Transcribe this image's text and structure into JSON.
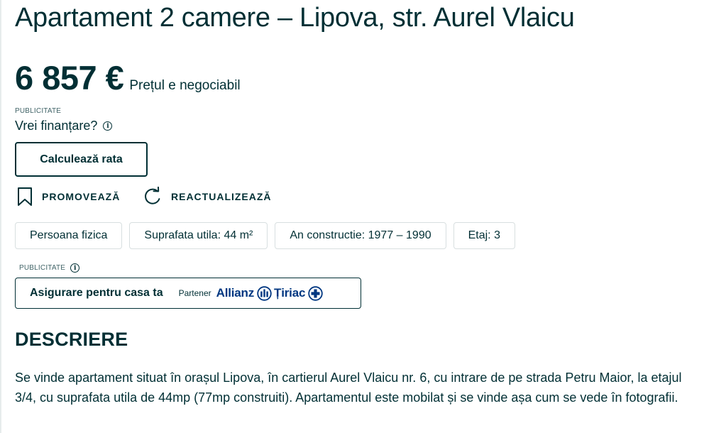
{
  "listing": {
    "title": "Apartament 2 camere – Lipova, str. Aurel Vlaicu",
    "price": "6 857 €",
    "price_note": "Prețul e negociabil"
  },
  "financing": {
    "ad_label": "PUBLICITATE",
    "question": "Vrei finanțare?",
    "info_icon": "i",
    "calc_button": "Calculează rata"
  },
  "actions": {
    "promote": "PROMOVEAZĂ",
    "refresh": "REACTUALIZEAZĂ"
  },
  "tags": [
    "Persoana fizica",
    "Suprafata utila: 44 m²",
    "An constructie: 1977 – 1990",
    "Etaj: 3"
  ],
  "insurance": {
    "ad_label": "PUBLICITATE",
    "info_icon": "i",
    "title": "Asigurare pentru casa ta",
    "partner_label": "Partener",
    "partner_name_1": "Allianz",
    "partner_name_2": "Țiriac"
  },
  "description": {
    "heading": "DESCRIERE",
    "text": "Se vinde apartament situat în orașul Lipova, în cartierul Aurel Vlaicu nr. 6, cu intrare de pe strada Petru Maior, la etajul 3/4, cu suprafata utila de 44mp (77mp construiti). Apartamentul este mobilat și se vinde așa cum se vede în fotografii."
  },
  "colors": {
    "text": "#002f34",
    "border": "#d8dfe0",
    "allianz": "#003781"
  },
  "icons": {
    "promote": "bookmark-icon",
    "refresh": "refresh-icon",
    "info": "info-icon",
    "allianz": "allianz-eagle-icon",
    "tiriac": "tiriac-cross-icon"
  }
}
